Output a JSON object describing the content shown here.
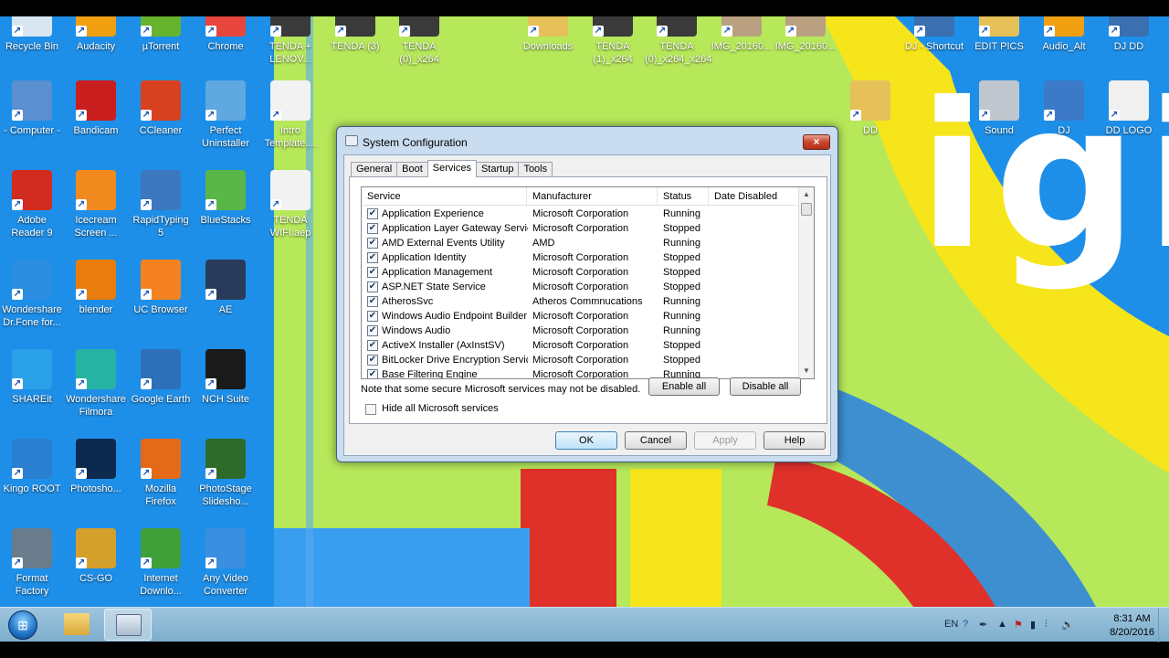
{
  "desktop": {
    "icons": [
      {
        "label": "Recycle Bin",
        "icon": "recycle-bin-icon",
        "color": "#d8e6f2"
      },
      {
        "label": "Audacity",
        "icon": "audacity-icon",
        "color": "#f0a010"
      },
      {
        "label": "µTorrent",
        "icon": "utorrent-icon",
        "color": "#66b32e"
      },
      {
        "label": "Chrome",
        "icon": "chrome-icon",
        "color": "#e8453c"
      },
      {
        "label": "TENDA + LENOV...",
        "icon": "video-file-icon",
        "color": "#3a3a3a"
      },
      {
        "label": "TENDA (3)",
        "icon": "video-file-icon",
        "color": "#3a3a3a"
      },
      {
        "label": "TENDA (0)_x264",
        "icon": "video-file-icon",
        "color": "#3a3a3a"
      },
      {
        "label": "Downloads",
        "icon": "downloads-folder-icon",
        "color": "#e6c15a"
      },
      {
        "label": "TENDA (1)_x264",
        "icon": "video-file-icon",
        "color": "#3a3a3a"
      },
      {
        "label": "TENDA (0)_x264_x264",
        "icon": "video-file-icon",
        "color": "#3a3a3a"
      },
      {
        "label": "IMG_20160...",
        "icon": "image-file-icon",
        "color": "#b9a080"
      },
      {
        "label": "IMG_20160...",
        "icon": "image-file-icon",
        "color": "#b9a080"
      },
      {
        "label": "DJ - Shortcut",
        "icon": "folder-shortcut-icon",
        "color": "#3a6fb0"
      },
      {
        "label": "EDIT PICS",
        "icon": "folder-icon",
        "color": "#e6c15a"
      },
      {
        "label": "Audio_Alt",
        "icon": "folder-icon",
        "color": "#f0a010"
      },
      {
        "label": "DJ DD",
        "icon": "folder-icon",
        "color": "#3a6fb0"
      },
      {
        "label": "- Computer -",
        "icon": "computer-icon",
        "color": "#5a8fd0"
      },
      {
        "label": "Bandicam",
        "icon": "bandicam-icon",
        "color": "#c81e1e"
      },
      {
        "label": "CCleaner",
        "icon": "ccleaner-icon",
        "color": "#d8411f"
      },
      {
        "label": "Perfect Uninstaller",
        "icon": "uninstaller-icon",
        "color": "#5fa8e0"
      },
      {
        "label": "Intro Template....",
        "icon": "document-file-icon",
        "color": "#f2f2f2"
      },
      {
        "label": "DD",
        "icon": "folder-icon",
        "color": "#e6c15a"
      },
      {
        "label": "Sound",
        "icon": "speaker-icon",
        "color": "#c0c7cf"
      },
      {
        "label": "DJ",
        "icon": "monitor-icon",
        "color": "#3c7ac8"
      },
      {
        "label": "DD LOGO",
        "icon": "logo-file-icon",
        "color": "#f0f0f0"
      },
      {
        "label": "Adobe Reader 9",
        "icon": "adobe-reader-icon",
        "color": "#d22b20"
      },
      {
        "label": "Icecream Screen ...",
        "icon": "icecream-icon",
        "color": "#f08a1e"
      },
      {
        "label": "RapidTyping 5",
        "icon": "rapidtyping-icon",
        "color": "#3d77c0"
      },
      {
        "label": "BlueStacks",
        "icon": "bluestacks-icon",
        "color": "#58b748"
      },
      {
        "label": "TENDA WIFI.aep",
        "icon": "document-file-icon",
        "color": "#f2f2f2"
      },
      {
        "label": "Wondershare Dr.Fone for...",
        "icon": "drfone-icon",
        "color": "#2a8de0"
      },
      {
        "label": "blender",
        "icon": "blender-icon",
        "color": "#e87d0d"
      },
      {
        "label": "UC Browser",
        "icon": "ucbrowser-icon",
        "color": "#f58220"
      },
      {
        "label": "AE",
        "icon": "after-effects-icon",
        "color": "#2a3a5a"
      },
      {
        "label": "SHAREit",
        "icon": "shareit-icon",
        "color": "#2aa0e8"
      },
      {
        "label": "Wondershare Filmora",
        "icon": "filmora-icon",
        "color": "#27b3a3"
      },
      {
        "label": "Google Earth",
        "icon": "google-earth-icon",
        "color": "#2d6fb8"
      },
      {
        "label": "NCH Suite",
        "icon": "nch-icon",
        "color": "#1a1a1a"
      },
      {
        "label": "Kingo ROOT",
        "icon": "kingo-root-icon",
        "color": "#2a7fd0"
      },
      {
        "label": "Photosho...",
        "icon": "photoshop-icon",
        "color": "#0b2a4d"
      },
      {
        "label": "Mozilla Firefox",
        "icon": "firefox-icon",
        "color": "#e56a18"
      },
      {
        "label": "PhotoStage Slidesho...",
        "icon": "photostage-icon",
        "color": "#2e6b2a"
      },
      {
        "label": "Format Factory",
        "icon": "format-factory-icon",
        "color": "#6a7b8c"
      },
      {
        "label": "CS-GO",
        "icon": "csgo-icon",
        "color": "#d59f2b"
      },
      {
        "label": "Internet Downlo...",
        "icon": "idm-icon",
        "color": "#3fa03a"
      },
      {
        "label": "Any Video Converter",
        "icon": "video-converter-icon",
        "color": "#3a8fe0"
      }
    ],
    "wallpaper_text": "igi"
  },
  "dialog": {
    "title": "System Configuration",
    "close_label": "×",
    "tabs": [
      "General",
      "Boot",
      "Services",
      "Startup",
      "Tools"
    ],
    "active_tab": "Services",
    "columns": [
      "Service",
      "Manufacturer",
      "Status",
      "Date Disabled"
    ],
    "rows": [
      {
        "checked": true,
        "service": "Application Experience",
        "manufacturer": "Microsoft Corporation",
        "status": "Running"
      },
      {
        "checked": true,
        "service": "Application Layer Gateway Service",
        "manufacturer": "Microsoft Corporation",
        "status": "Stopped"
      },
      {
        "checked": true,
        "service": "AMD External Events Utility",
        "manufacturer": "AMD",
        "status": "Running"
      },
      {
        "checked": true,
        "service": "Application Identity",
        "manufacturer": "Microsoft Corporation",
        "status": "Stopped"
      },
      {
        "checked": true,
        "service": "Application Management",
        "manufacturer": "Microsoft Corporation",
        "status": "Stopped"
      },
      {
        "checked": true,
        "service": "ASP.NET State Service",
        "manufacturer": "Microsoft Corporation",
        "status": "Stopped"
      },
      {
        "checked": true,
        "service": "AtherosSvc",
        "manufacturer": "Atheros Commnucations",
        "status": "Running"
      },
      {
        "checked": true,
        "service": "Windows Audio Endpoint Builder",
        "manufacturer": "Microsoft Corporation",
        "status": "Running"
      },
      {
        "checked": true,
        "service": "Windows Audio",
        "manufacturer": "Microsoft Corporation",
        "status": "Running"
      },
      {
        "checked": true,
        "service": "ActiveX Installer (AxInstSV)",
        "manufacturer": "Microsoft Corporation",
        "status": "Stopped"
      },
      {
        "checked": true,
        "service": "BitLocker Drive Encryption Service",
        "manufacturer": "Microsoft Corporation",
        "status": "Stopped"
      },
      {
        "checked": true,
        "service": "Base Filtering Engine",
        "manufacturer": "Microsoft Corporation",
        "status": "Running"
      }
    ],
    "note": "Note that some secure Microsoft services may not be disabled.",
    "enable_all_label": "Enable all",
    "disable_all_label": "Disable all",
    "hide_ms_label": "Hide all Microsoft services",
    "ok_label": "OK",
    "cancel_label": "Cancel",
    "apply_label": "Apply",
    "help_label": "Help"
  },
  "taskbar": {
    "start_icon": "windows-start-icon",
    "language": "EN",
    "time": "8:31 AM",
    "date": "8/20/2016"
  },
  "colors": {
    "desktop_blue": "#1e8fe8",
    "wallpaper_green": "#b6e85a",
    "wallpaper_yellow": "#f5e51a",
    "wallpaper_red": "#e0302a"
  }
}
